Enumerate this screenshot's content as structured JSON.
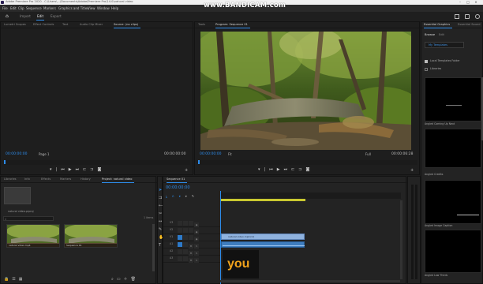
{
  "titlebar": {
    "title": "Adobe Premiere Pro 2020 - C:\\Users\\...\\Documents\\Adobe\\Premiere Pro\\14.0\\natural video"
  },
  "menu": [
    "File",
    "Edit",
    "Clip",
    "Sequence",
    "Markers",
    "Graphics and Titles",
    "View",
    "Window",
    "Help"
  ],
  "workspaces": {
    "home_icon": "home-icon",
    "items": [
      "Import",
      "Edit",
      "Export"
    ],
    "active": "Edit"
  },
  "watermark": "www.BANDICAM.com",
  "sequence_title": "natural video",
  "source": {
    "tabs": [
      "Lumetri Scopes",
      "Effect Controls",
      "Text",
      "Audio Clip Mixer",
      "Source: (no clips)"
    ],
    "active": "Source: (no clips)",
    "timecode_left": "00:00:00:00",
    "page": "Page 1",
    "timecode_right": "00:00:00:00"
  },
  "program": {
    "tabs": [
      "Tools",
      "Program: Sequence 01"
    ],
    "active": "Program: Sequence 01",
    "timecode_left": "00:00:00:00",
    "fit": "Fit",
    "full": "Full",
    "timecode_right": "00:00:06:28"
  },
  "essential": {
    "tabs": [
      "Essential Graphics",
      "Essential Sound"
    ],
    "subtabs": [
      "Browse",
      "Edit"
    ],
    "templates_btn": "My Templates",
    "chk_local": "Local Templates Folder",
    "chk_adobe": "Libraries",
    "items": [
      "Angled Coming Up Next",
      "Angled Credits",
      "Angled Image Caption",
      "Angled Low Thirds"
    ]
  },
  "project": {
    "tabs": [
      "Libraries",
      "Info",
      "Effects",
      "Markers",
      "History",
      "Project: natural video"
    ],
    "active": "Project: natural video",
    "file": "natural video.prproj",
    "count": "1 items",
    "bins": [
      {
        "name": "natural video.mp4"
      },
      {
        "name": "Sequence 01"
      }
    ]
  },
  "timeline": {
    "tab": "Sequence 01",
    "timecode": "00:00:00:00",
    "tracks": [
      "V3",
      "V2",
      "V1",
      "A1",
      "A2",
      "A3"
    ],
    "clip_label": "natural video.mp4 [V]"
  },
  "overlay_text": "you",
  "colors": {
    "accent": "#2d8ceb",
    "clip_video": "#8fb2de",
    "clip_audio": "#3e7dbf",
    "you_text": "#f0a21c"
  }
}
